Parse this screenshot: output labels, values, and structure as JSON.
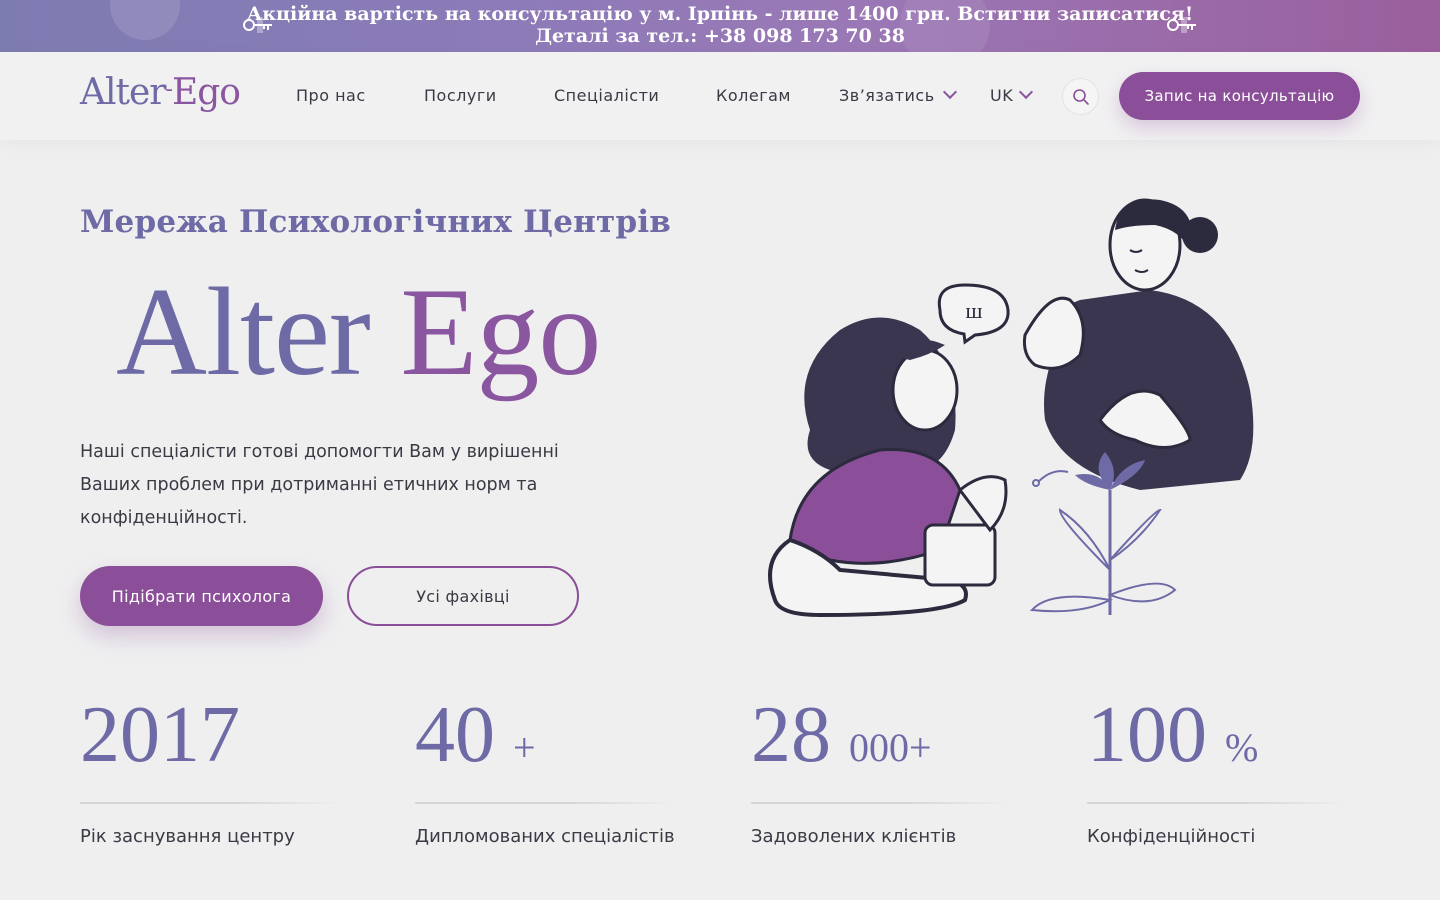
{
  "promo": {
    "line1": "Акційна вартість на консультацію у м. Ірпінь - лише 1400 грн. Встигни записатися!",
    "line2": "Деталі за тел.: +38 098 173 70 38"
  },
  "header": {
    "logo_alter": "Alter",
    "logo_ego": "Ego",
    "nav": [
      "Про нас",
      "Послуги",
      "Спеціалісти",
      "Колегам",
      "Зв’язатись"
    ],
    "lang": "UK",
    "cta": "Запис на консультацію"
  },
  "hero": {
    "subtitle": "Мережа Психологічних Центрів",
    "title_alter": "Alter",
    "title_ego": "Ego",
    "description": "Наші спеціалісти готові допомогти Вам у вирішенні Ваших проблем при дотриманні етичних норм та конфіденційності.",
    "btn_primary": "Підібрати психолога",
    "btn_secondary": "Усі фахівці",
    "speech_bubble": "ш"
  },
  "stats": [
    {
      "value": "2017",
      "suffix": "",
      "label": "Рік заснування центру"
    },
    {
      "value": "40",
      "suffix": "+",
      "label": "Дипломованих спеціалістів"
    },
    {
      "value": "28",
      "suffix": "000+",
      "label": "Задоволених клієнтів"
    },
    {
      "value": "100",
      "suffix": "%",
      "label": "Конфіденційності"
    }
  ],
  "colors": {
    "accent": "#8a4f98",
    "brand_violet": "#6d6aa6",
    "dark_ink": "#3a3650",
    "background": "#efeff0"
  },
  "icons": [
    "key-icon",
    "search-icon",
    "chevron-down-icon"
  ]
}
